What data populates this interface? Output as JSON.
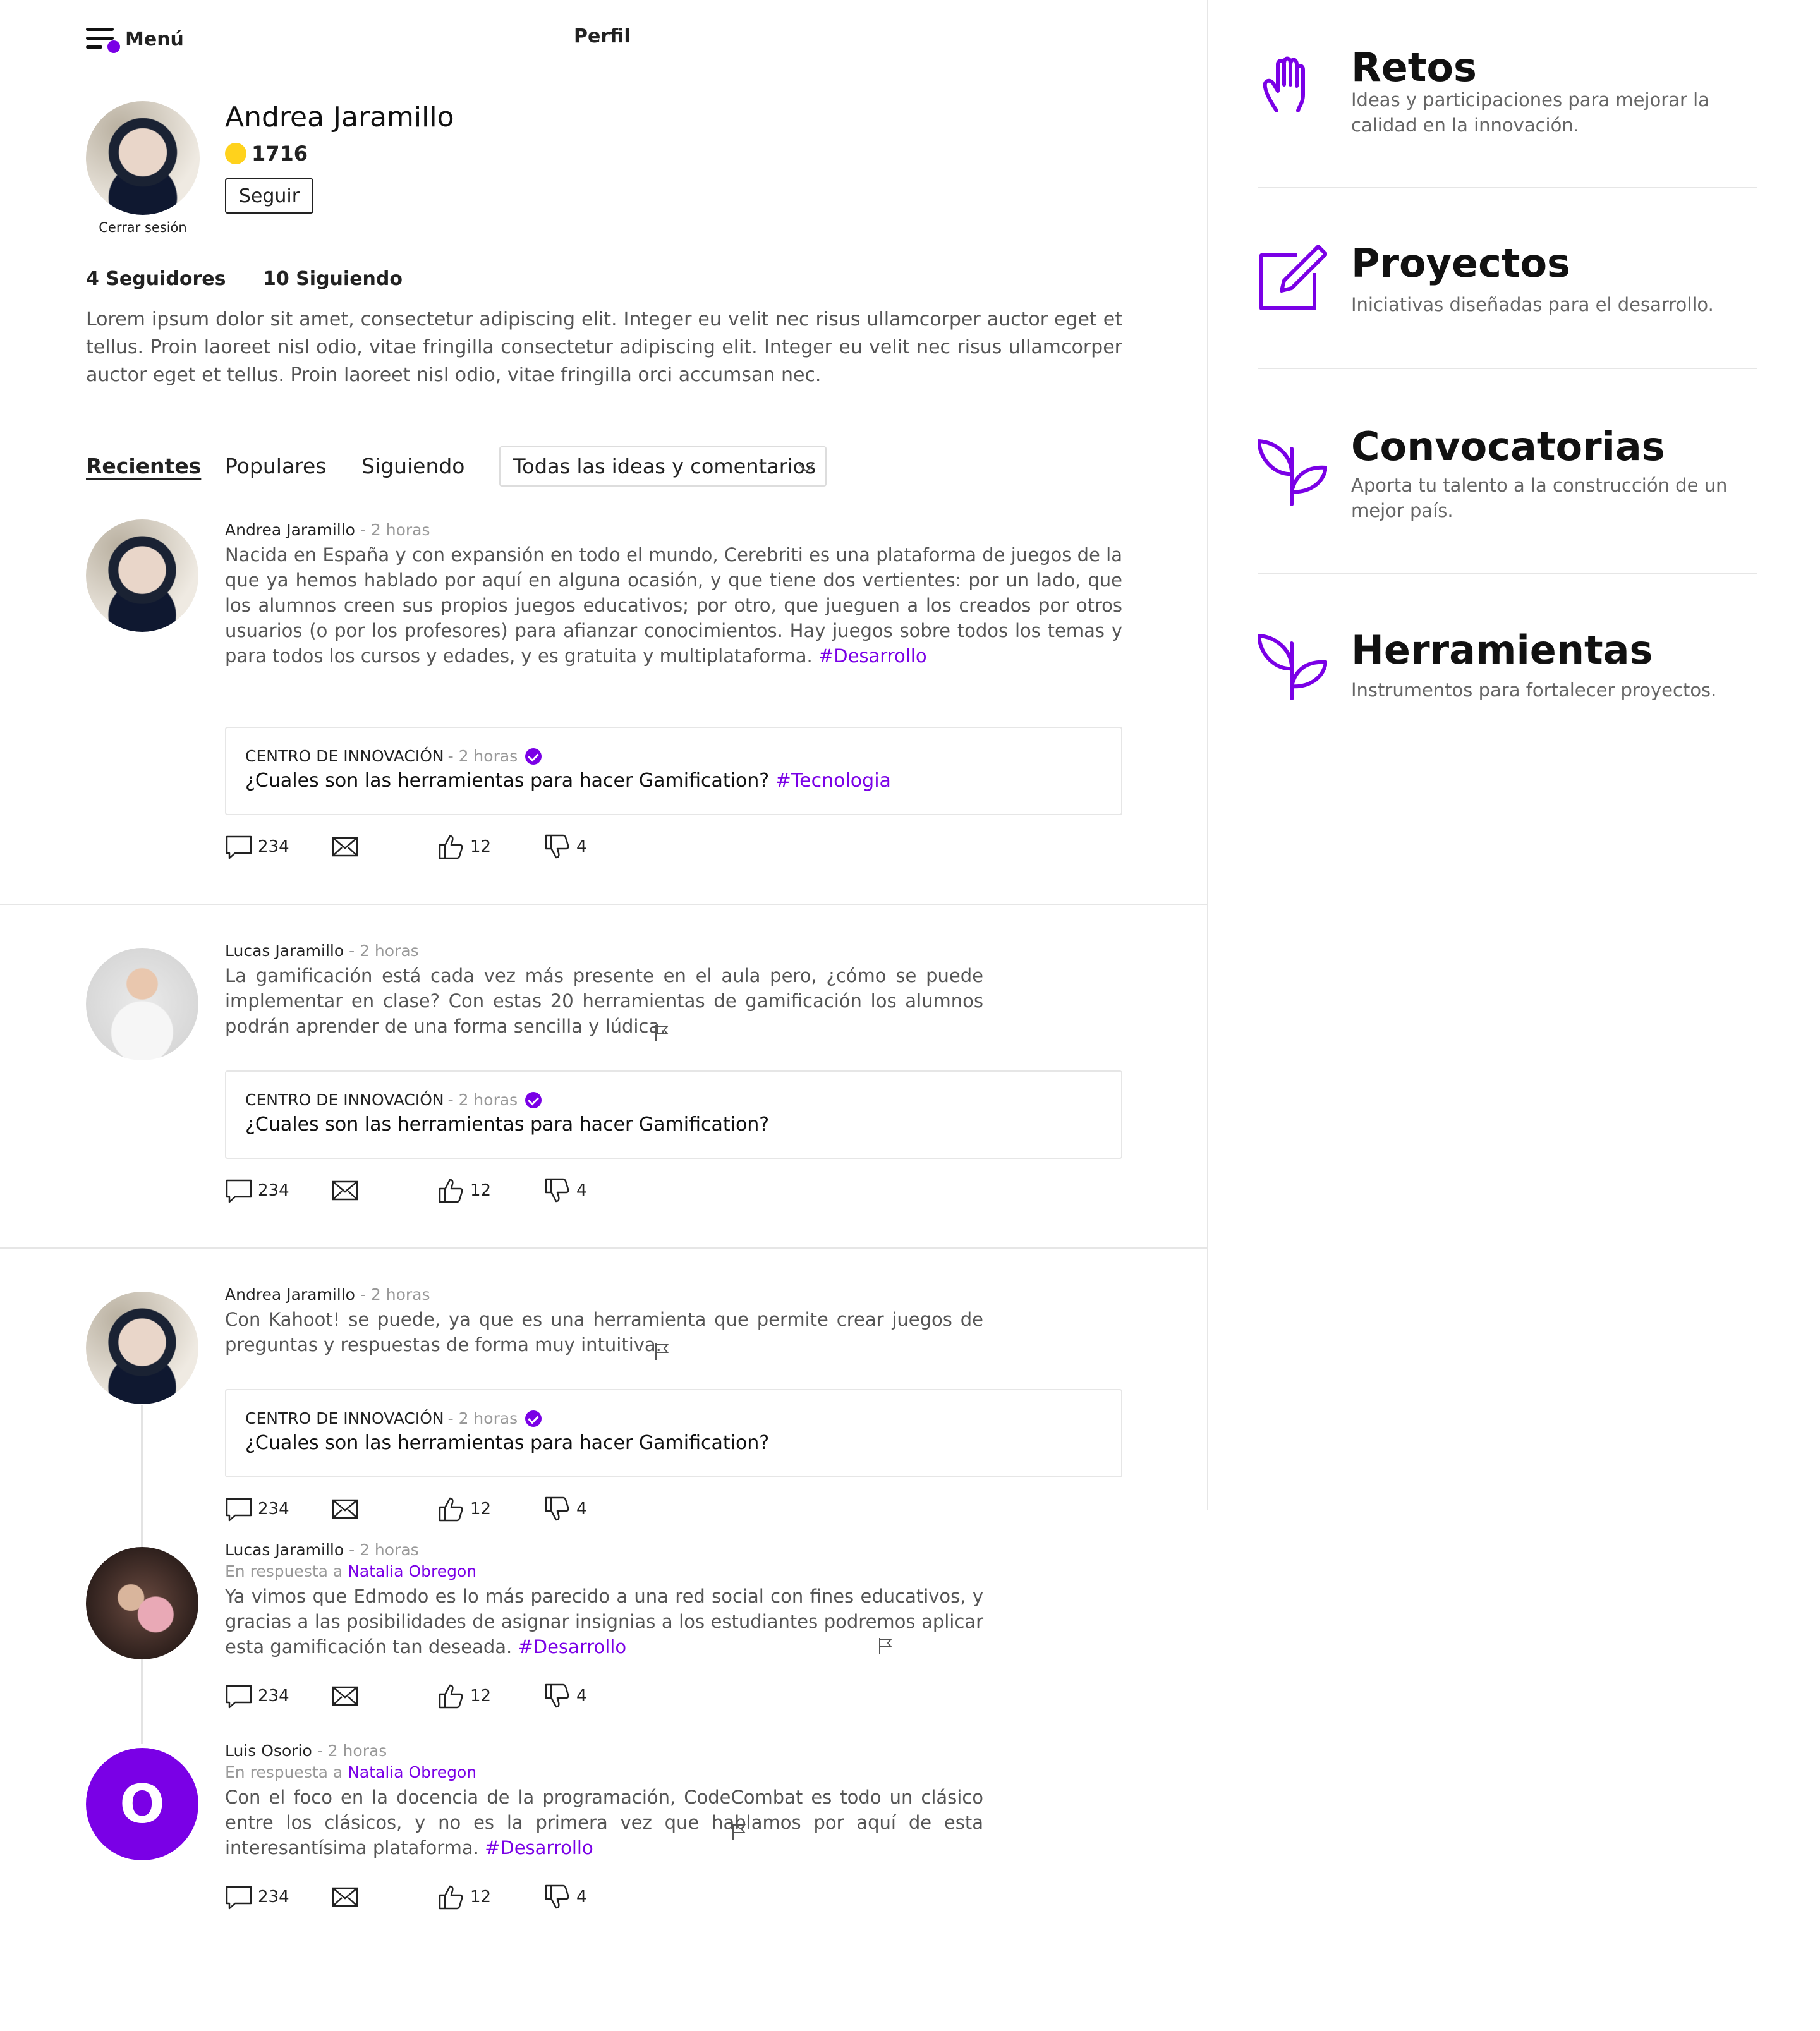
{
  "header": {
    "menu_label": "Menú",
    "title": "Perfil"
  },
  "profile": {
    "name": "Andrea Jaramillo",
    "points": "1716",
    "follow_label": "Seguir",
    "logout_label": "Cerrar sesión",
    "followers": "4 Seguidores",
    "following": "10 Siguiendo",
    "bio": "Lorem ipsum dolor sit amet, consectetur adipiscing elit. Integer eu velit nec risus ullamcorper auctor eget et tellus. Proin laoreet nisl odio, vitae fringilla consectetur adipiscing elit. Integer eu velit nec risus ullamcorper auctor eget et tellus. Proin laoreet nisl odio, vitae fringilla orci accumsan nec."
  },
  "tabs": {
    "recientes": "Recientes",
    "populares": "Populares",
    "siguiendo": "Siguiendo",
    "filter": "Todas las ideas y comentarios"
  },
  "posts": [
    {
      "author": "Andrea Jaramillo",
      "time": "- 2 horas",
      "text": "Nacida en España y con expansión en todo el mundo, Cerebriti es una plataforma de juegos de la que ya hemos hablado por aquí en alguna ocasión, y que tiene dos vertientes: por un lado, que los alumnos creen sus propios juegos educativos; por otro, que jueguen a los creados por otros usuarios (o por los profesores) para afianzar conocimientos. Hay juegos sobre todos los temas y para todos los cursos y edades, y es gratuita y multiplataforma.",
      "tag": "#Desarrollo",
      "quote": {
        "org": "CENTRO DE INNOVACIÓN",
        "time": "- 2 horas",
        "question": "¿Cuales son las herramientas para hacer Gamification?",
        "tag": "#Tecnologia"
      },
      "comments": "234",
      "likes": "12",
      "dislikes": "4"
    },
    {
      "author": "Lucas Jaramillo",
      "time": "- 2 horas",
      "text": "La gamificación está cada vez más presente en el aula pero, ¿cómo se puede implementar en clase? Con estas 20 herramientas de gamificación los alumnos podrán aprender de una forma sencilla y lúdica.",
      "quote": {
        "org": "CENTRO DE INNOVACIÓN",
        "time": "- 2 horas",
        "question": "¿Cuales son las herramientas para hacer Gamification?"
      },
      "comments": "234",
      "likes": "12",
      "dislikes": "4"
    },
    {
      "author": "Andrea Jaramillo",
      "time": "- 2 horas",
      "text": "Con Kahoot! se puede, ya que es una herramienta que permite crear juegos de preguntas y respuestas de forma muy intuitiva.",
      "quote": {
        "org": "CENTRO DE INNOVACIÓN",
        "time": "- 2 horas",
        "question": "¿Cuales son las herramientas para hacer Gamification?"
      },
      "comments": "234",
      "likes": "12",
      "dislikes": "4"
    },
    {
      "author": "Lucas Jaramillo",
      "time": "- 2 horas",
      "reply_prefix": "En respuesta a",
      "reply_to": "Natalia Obregon",
      "text": "Ya vimos que Edmodo es lo más parecido a una red social con fines educativos, y gracias a las posibilidades de asignar insignias a los estudiantes podremos aplicar esta gamificación tan deseada.",
      "tag": "#Desarrollo",
      "comments": "234",
      "likes": "12",
      "dislikes": "4"
    },
    {
      "author": "Luis Osorio",
      "avatar_letter": "O",
      "time": "- 2 horas",
      "reply_prefix": "En respuesta a",
      "reply_to": "Natalia Obregon",
      "text": "Con el foco en la docencia de la programación, CodeCombat es todo un clásico entre los clásicos, y no es la primera vez que hablamos por aquí de esta interesantísima plataforma.",
      "tag": "#Desarrollo",
      "comments": "234",
      "likes": "12",
      "dislikes": "4"
    }
  ],
  "sidebar": [
    {
      "title": "Retos",
      "desc": "Ideas  y participaciones para mejorar la calidad en la innovación.",
      "icon": "hand-icon"
    },
    {
      "title": "Proyectos",
      "desc": "Iniciativas diseñadas para el desarrollo.",
      "icon": "edit-icon"
    },
    {
      "title": "Convocatorias",
      "desc": "Aporta tu talento a la construcción de un mejor país.",
      "icon": "sprout-icon"
    },
    {
      "title": "Herramientas",
      "desc": "Instrumentos para fortalecer proyectos.",
      "icon": "sprout-icon"
    }
  ],
  "colors": {
    "accent": "#7a00e6",
    "coin": "#ffd21c"
  }
}
